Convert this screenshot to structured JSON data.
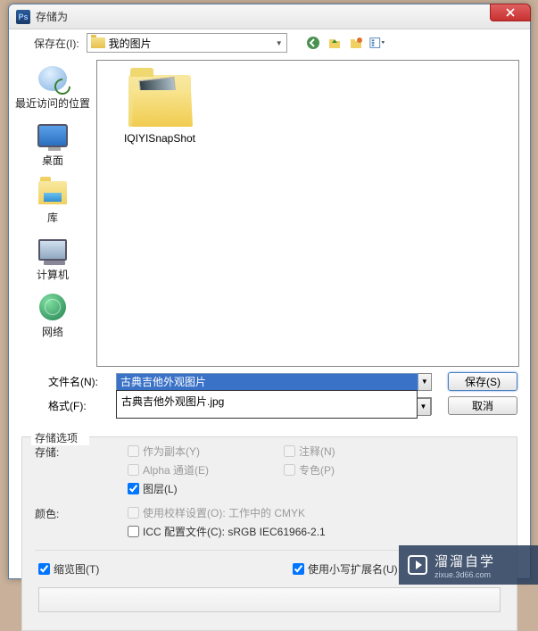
{
  "window": {
    "title": "存储为"
  },
  "topbar": {
    "save_in_label": "保存在(I):",
    "location": "我的图片"
  },
  "places": {
    "recent": "最近访问的位置",
    "desktop": "桌面",
    "libraries": "库",
    "computer": "计算机",
    "network": "网络"
  },
  "file_area": {
    "folder_name": "IQIYISnapShot"
  },
  "fields": {
    "filename_label": "文件名(N):",
    "filename_value": "古典吉他外观图片",
    "filename_suggestion": "古典吉他外观图片.jpg",
    "format_label": "格式(F):"
  },
  "buttons": {
    "save": "保存(S)",
    "cancel": "取消"
  },
  "options": {
    "section_title": "存储选项",
    "save_label": "存储:",
    "as_copy": "作为副本(Y)",
    "notes": "注释(N)",
    "alpha": "Alpha 通道(E)",
    "spot": "专色(P)",
    "layers": "图层(L)",
    "color_label": "颜色:",
    "proof": "使用校样设置(O):  工作中的 CMYK",
    "icc": "ICC 配置文件(C):  sRGB IEC61966-2.1",
    "thumbnail": "缩览图(T)",
    "lowercase_ext": "使用小写扩展名(U)"
  },
  "watermark": {
    "line1": "溜溜自学",
    "line2": "zixue.3d66.com"
  }
}
